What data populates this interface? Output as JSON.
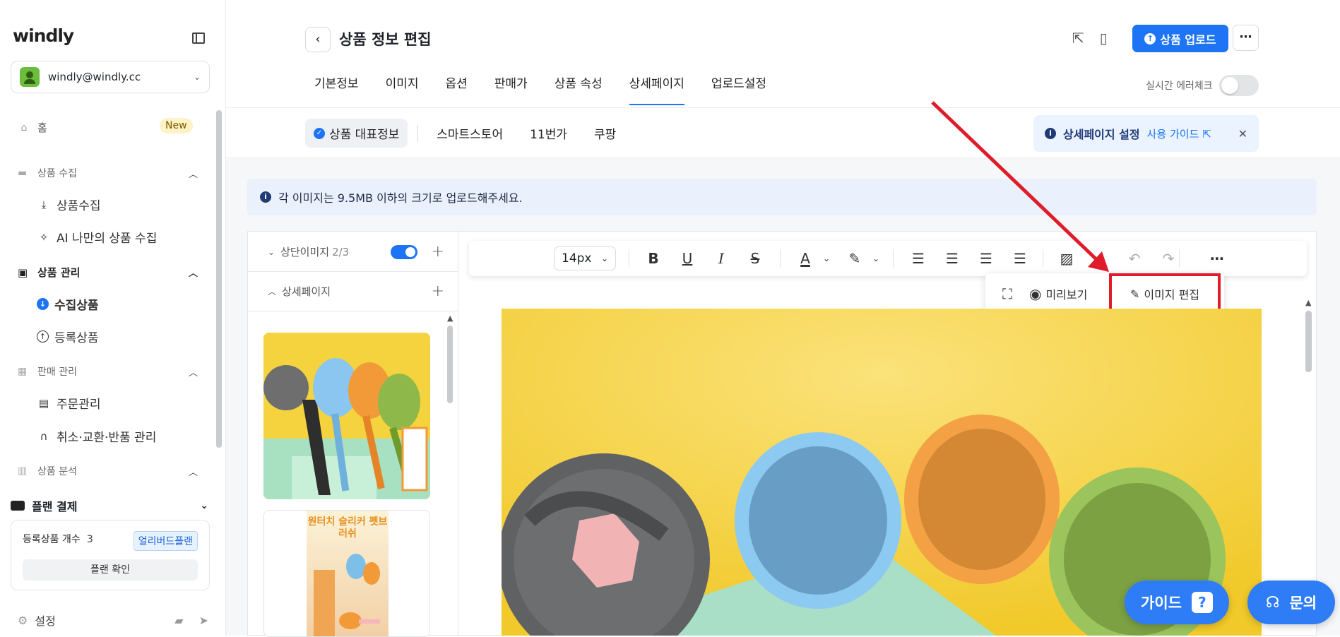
{
  "sidebar": {
    "logo": "windly",
    "account": "windly@windly.cc",
    "home": {
      "label": "홈",
      "badge": "New"
    },
    "sections": [
      {
        "label": "상품 수집",
        "items": [
          "상품수집",
          "AI 나만의 상품 수집"
        ]
      },
      {
        "label": "상품 관리",
        "items": [
          "수집상품",
          "등록상품"
        ]
      },
      {
        "label": "판매 관리",
        "items": [
          "주문관리",
          "취소·교환·반품 관리"
        ]
      },
      {
        "label": "상품 분석",
        "items": []
      }
    ],
    "plan": {
      "title": "플랜 결제",
      "count_label": "등록상품 개수",
      "count_value": "3",
      "plan_name": "얼리버드플랜",
      "check_button": "플랜 확인"
    },
    "settings": "설정"
  },
  "header": {
    "title": "상품 정보 편집",
    "upload_button": "상품 업로드",
    "tabs": [
      "기본정보",
      "이미지",
      "옵션",
      "판매가",
      "상품 속성",
      "상세페이지",
      "업로드설정"
    ],
    "active_tab": "상세페이지",
    "realtime_check": "실시간 에러체크"
  },
  "subtabs": [
    "상품 대표정보",
    "스마트스토어",
    "11번가",
    "쿠팡"
  ],
  "guide": {
    "label": "상세페이지 설정",
    "link": "사용 가이드"
  },
  "notice": "각 이미지는 9.5MB 이하의 크기로 업로드해주세요.",
  "left_panel": {
    "top_images": "상단이미지",
    "top_images_count": "2/3",
    "detail_page": "상세페이지",
    "thumb2_title": "원터치 슬리커 펫브러쉬"
  },
  "toolbar": {
    "font_size": "14px"
  },
  "image_menu": {
    "preview": "미리보기",
    "edit": "이미지 편집"
  },
  "floating": {
    "guide": "가이드",
    "ask": "문의"
  },
  "colors": {
    "accent": "#1d74f5",
    "highlight": "#e01b2a"
  }
}
